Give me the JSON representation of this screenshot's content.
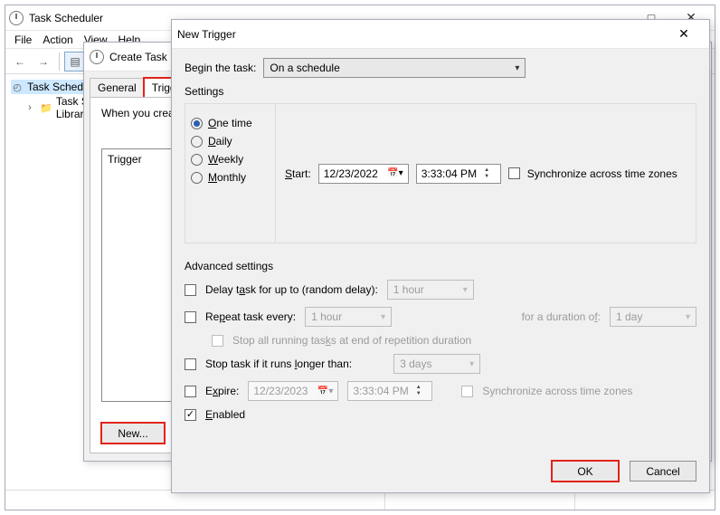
{
  "mainwin": {
    "title": "Task Scheduler",
    "menu": [
      "File",
      "Action",
      "View",
      "Help"
    ],
    "tree": {
      "root": "Task Scheduler",
      "child": "Task Scheduler Library"
    }
  },
  "create_task": {
    "title": "Create Task",
    "tabs": [
      "General",
      "Triggers"
    ],
    "body_text": "When you create",
    "column_header": "Trigger",
    "new_button": "New..."
  },
  "new_trigger": {
    "title": "New Trigger",
    "begin_label": "Begin the task:",
    "begin_value": "On a schedule",
    "settings_label": "Settings",
    "radios": {
      "one_time": "One time",
      "daily": "Daily",
      "weekly": "Weekly",
      "monthly": "Monthly"
    },
    "start_label": "Start:",
    "start_date": "12/23/2022",
    "start_time": "3:33:04 PM",
    "sync_tz": "Synchronize across time zones",
    "advanced_label": "Advanced settings",
    "delay_label": "Delay task for up to (random delay):",
    "delay_value": "1 hour",
    "repeat_label": "Repeat task every:",
    "repeat_value": "1 hour",
    "duration_label": "for a duration of:",
    "duration_value": "1 day",
    "stop_running_label": "Stop all running tasks at end of repetition duration",
    "stop_longer_label": "Stop task if it runs longer than:",
    "stop_longer_value": "3 days",
    "expire_label": "Expire:",
    "expire_date": "12/23/2023",
    "expire_time": "3:33:04 PM",
    "expire_sync": "Synchronize across time zones",
    "enabled_label": "Enabled",
    "ok": "OK",
    "cancel": "Cancel"
  }
}
